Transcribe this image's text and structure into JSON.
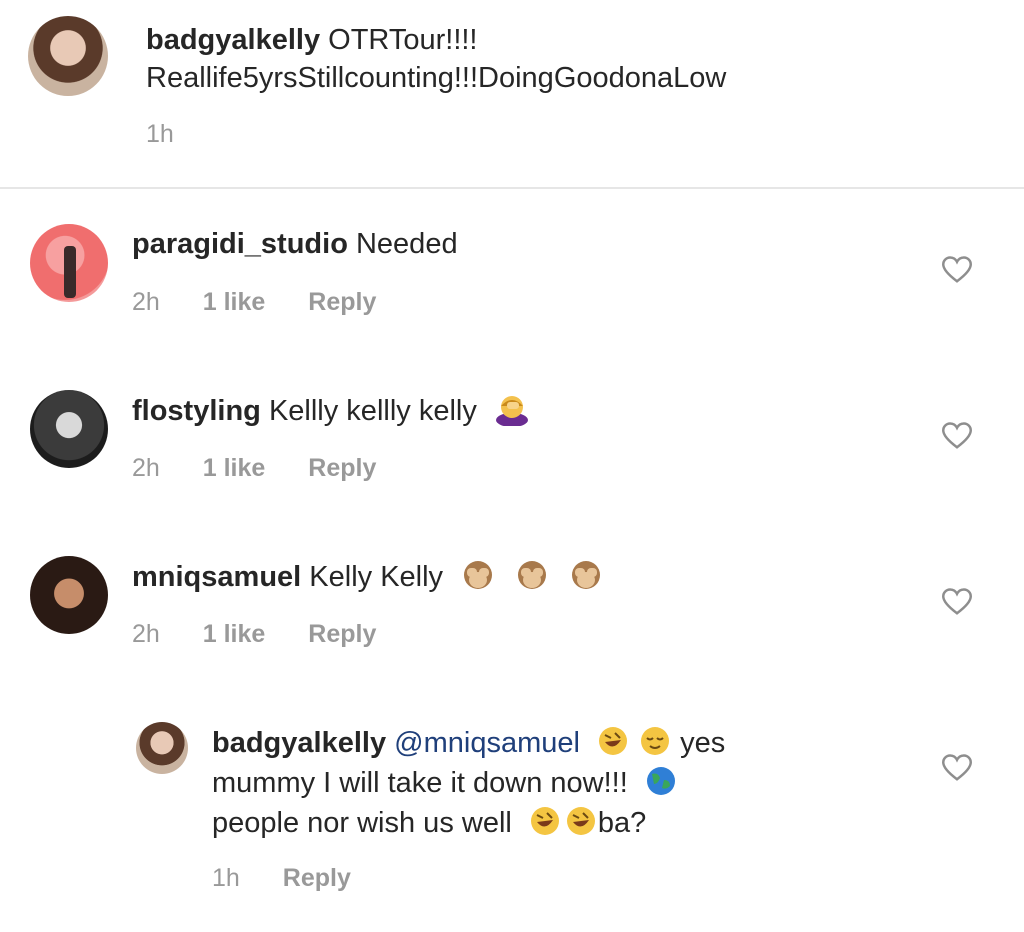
{
  "caption": {
    "username": "badgyalkelly",
    "text_line1": "OTRTour!!!!",
    "text_line2": "Reallife5yrsStillcounting!!!DoingGoodonaLow",
    "time": "1h"
  },
  "comments": [
    {
      "username": "paragidi_studio",
      "text": "Needed",
      "time": "2h",
      "likes": "1 like",
      "reply_label": "Reply"
    },
    {
      "username": "flostyling",
      "text": "Kellly kellly kelly",
      "emoji": [
        "woman-facepalming-emoji"
      ],
      "time": "2h",
      "likes": "1 like",
      "reply_label": "Reply"
    },
    {
      "username": "mniqsamuel",
      "text": "Kelly Kelly",
      "emoji": [
        "see-no-evil-monkey-emoji",
        "see-no-evil-monkey-emoji",
        "see-no-evil-monkey-emoji"
      ],
      "time": "2h",
      "likes": "1 like",
      "reply_label": "Reply"
    }
  ],
  "reply": {
    "username": "badgyalkelly",
    "mention": "@mniqsamuel",
    "text_line1_end": "yes",
    "text_line2": "mummy I will take it down now!!!",
    "text_line3_start": "people nor wish us well",
    "text_line3_end": "ba?",
    "emoji": [
      "rolling-on-floor-laughing-emoji",
      "relieved-face-emoji",
      "globe-emoji",
      "rolling-on-floor-laughing-emoji",
      "rolling-on-floor-laughing-emoji"
    ],
    "time": "1h",
    "reply_label": "Reply"
  },
  "colors": {
    "text": "#262626",
    "meta": "#999999",
    "mention": "#1f3f7a",
    "divider": "#e6e6e6"
  }
}
